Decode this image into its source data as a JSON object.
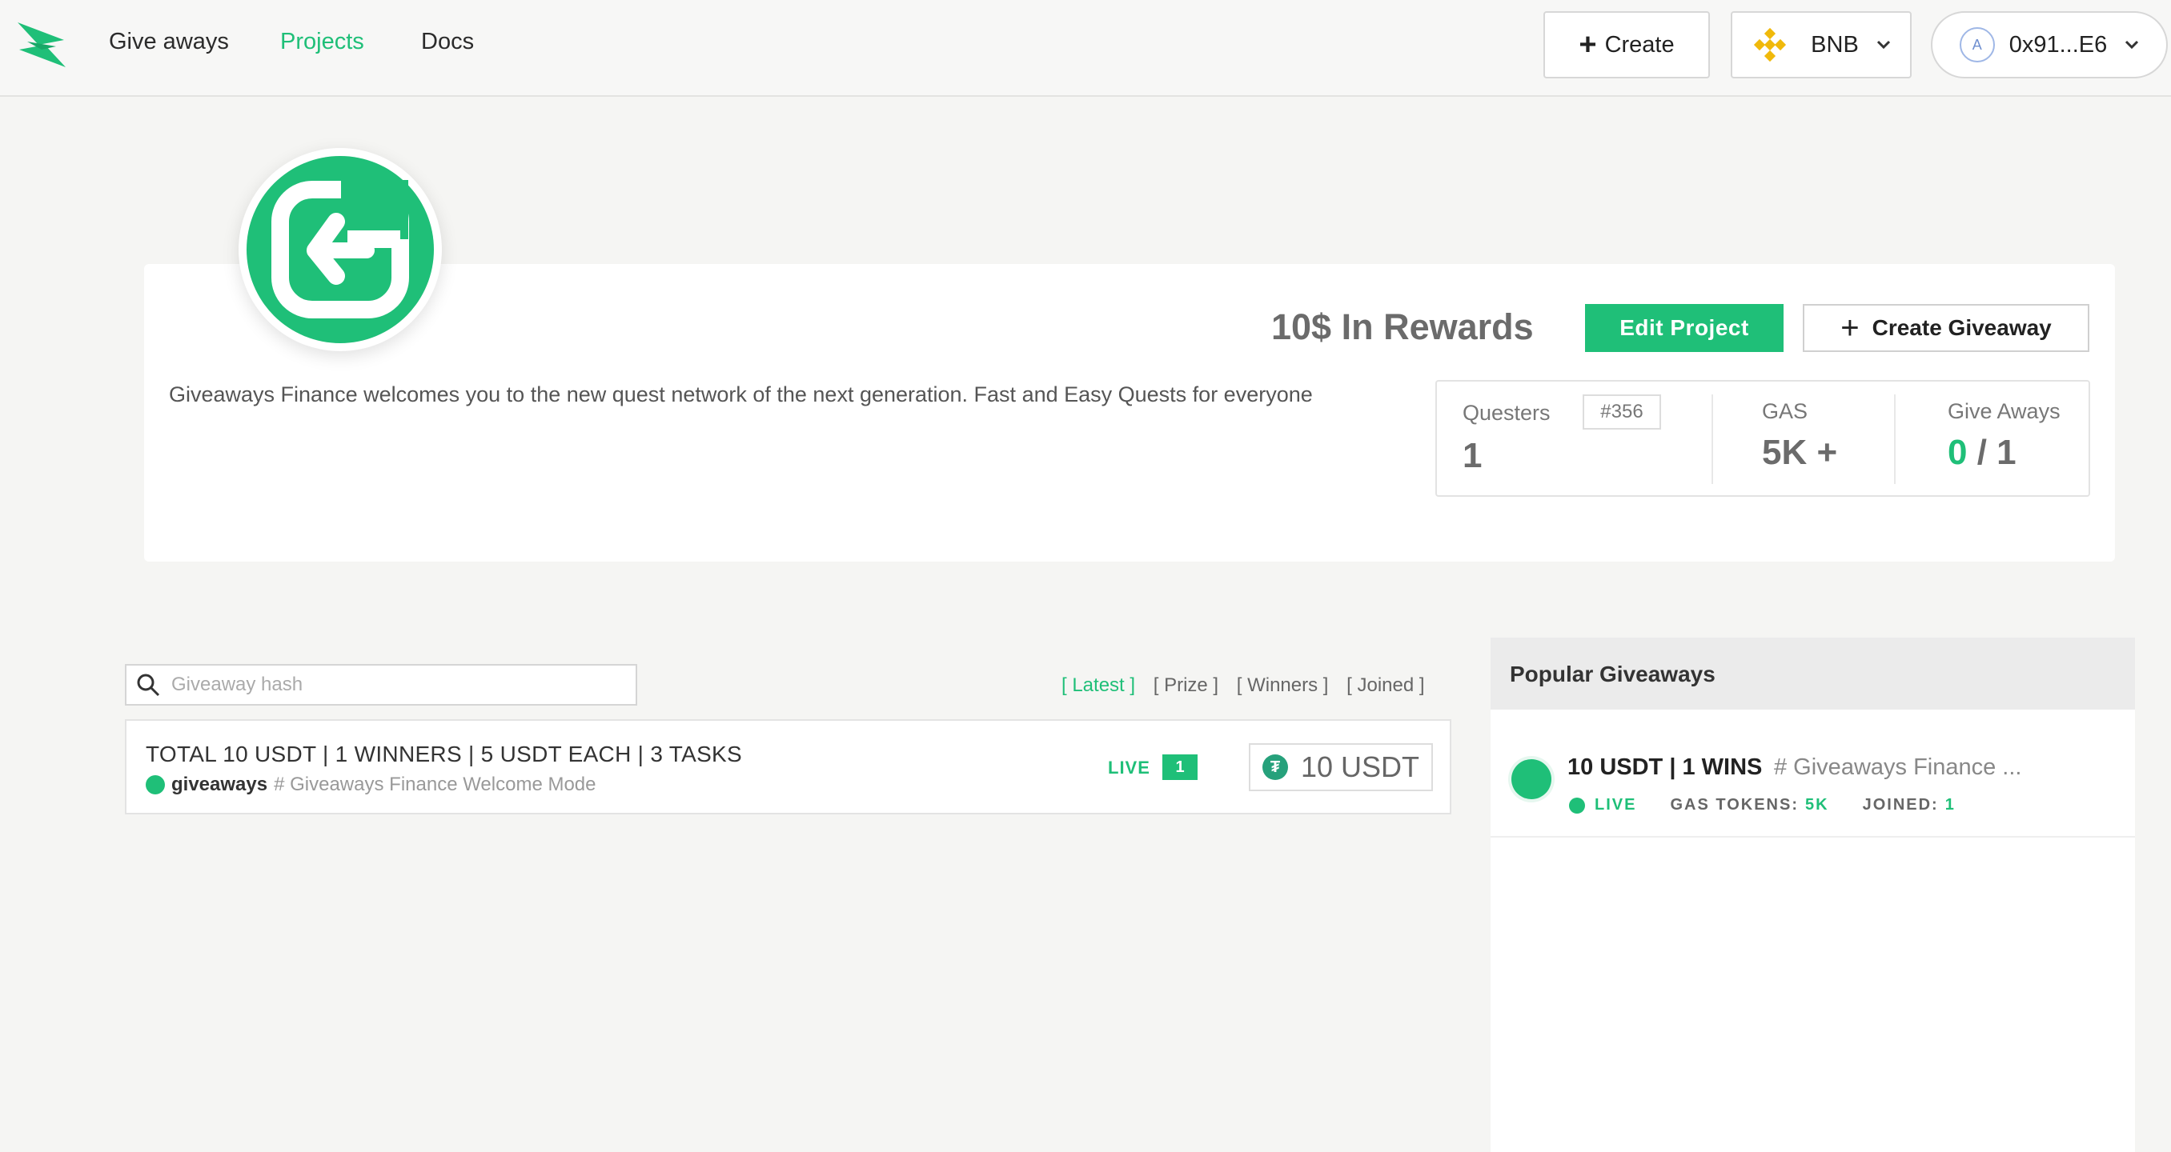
{
  "nav": {
    "links": [
      "Give aways",
      "Projects",
      "Docs"
    ],
    "active": "Projects",
    "create_label": "Create",
    "network_label": "BNB",
    "account_label": "0x91...E6",
    "avatar_letter": "A",
    "accent": "#1fbf78"
  },
  "project": {
    "description": "Giveaways Finance welcomes you to the new quest network of the next generation. Fast and Easy Quests for everyone",
    "rewards": "10$ In Rewards",
    "edit_label": "Edit Project",
    "create_giveaway_label": "Create Giveaway",
    "stats": {
      "questers_label": "Questers",
      "questers_badge": "#356",
      "questers_value": "1",
      "gas_label": "GAS",
      "gas_value": "5K +",
      "giveaways_label": "Give Aways",
      "giveaways_done": "0",
      "giveaways_total": "1"
    }
  },
  "list": {
    "search_placeholder": "Giveaway hash",
    "filters": [
      "[ Latest ]",
      "[ Prize ]",
      "[ Winners ]",
      "[ Joined ]"
    ],
    "active_filter": "[ Latest ]",
    "items": [
      {
        "title": "TOTAL 10 USDT | 1 WINNERS | 5 USDT EACH | 3 TASKS",
        "owner": "giveaways",
        "hash": "# Giveaways Finance Welcome Mode",
        "status": "LIVE",
        "count": "1",
        "prize": "10 USDT"
      }
    ]
  },
  "popular": {
    "header": "Popular Giveaways",
    "items": [
      {
        "title": "10 USDT | 1 WINS",
        "hash": "# Giveaways Finance ...",
        "status": "LIVE",
        "gas_label": "GAS TOKENS:",
        "gas_value": "5K",
        "joined_label": "JOINED:",
        "joined_value": "1"
      }
    ]
  }
}
